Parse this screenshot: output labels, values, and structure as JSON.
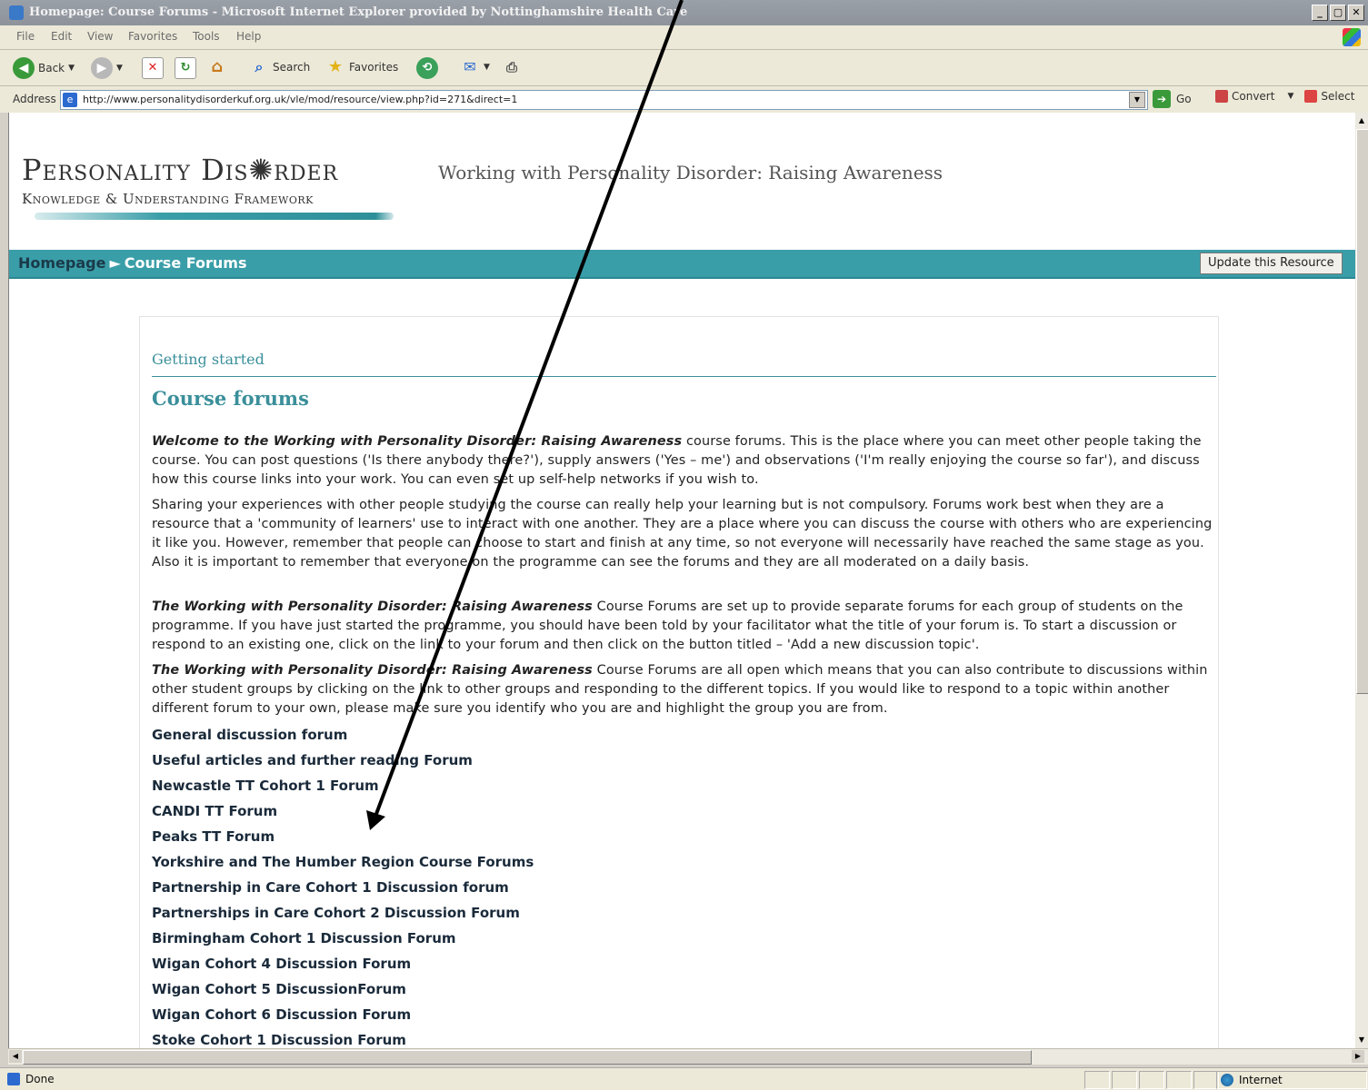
{
  "window": {
    "title": "Homepage: Course Forums - Microsoft Internet Explorer provided by Nottinghamshire Health Care",
    "controls": [
      "_",
      "▢",
      "✕"
    ]
  },
  "menu": [
    "File",
    "Edit",
    "View",
    "Favorites",
    "Tools",
    "Help"
  ],
  "toolbar": {
    "back_label": "Back",
    "search_label": "Search",
    "favorites_label": "Favorites"
  },
  "address": {
    "label": "Address",
    "url": "http://www.personalitydisorderkuf.org.uk/vle/mod/resource/view.php?id=271&direct=1",
    "go_label": "Go",
    "convert_label": "Convert",
    "select_label": "Select"
  },
  "page": {
    "logo_line1": "Personality Dis✺rder",
    "logo_line2": "Knowledge & Understanding Framework",
    "site_title": "Working with Personality Disorder: Raising Awareness",
    "breadcrumb_home": "Homepage",
    "breadcrumb_sep": "►",
    "breadcrumb_current": "Course Forums",
    "update_button": "Update this Resource",
    "section_label": "Getting started",
    "heading": "Course forums",
    "paragraphs": [
      {
        "bold": "Welcome to the Working with Personality Disorder: Raising Awareness",
        "text": " course forums. This is the place where you can meet other people taking the course. You can post questions ('Is there anybody there?'), supply answers ('Yes – me') and observations ('I'm really enjoying the course so far'), and discuss how this course links into your work. You can even set up self-help networks if you wish to."
      },
      {
        "bold": "",
        "text": "Sharing your experiences with other people studying the course can really help your learning but is not compulsory. Forums work best when they are a resource that a 'community of learners' use to interact with one another. They are a place where you can discuss the course with others who are experiencing it like you. However, remember that people can choose to start and finish at any time, so not everyone will necessarily have reached the same stage as you. Also it is important to remember that everyone on the programme can see the forums and they are all moderated on a daily basis."
      },
      {
        "bold": "The Working with Personality Disorder: Raising Awareness",
        "text": " Course Forums are set up to provide separate forums for each group of students on the programme. If you have just started the programme, you should have been told by your facilitator what the title of your forum is. To start a discussion or respond to an existing one, click on the link to your forum and then click on the button titled – 'Add a new discussion topic'."
      },
      {
        "bold": "The Working with Personality Disorder: Raising Awareness",
        "text": " Course Forums are all open which means that you can also contribute to discussions within other student groups by clicking on the link to other groups and responding to the different topics. If you would like to respond to a topic within another different forum to your own, please make sure you identify who you are and highlight the group you are from."
      }
    ],
    "forums": [
      "General discussion forum",
      "Useful articles and further reading Forum",
      "Newcastle TT Cohort 1 Forum",
      "CANDI TT Forum",
      "Peaks TT Forum",
      "Yorkshire and The Humber Region Course Forums",
      "Partnership in Care Cohort 1 Discussion forum",
      "Partnerships in Care Cohort 2 Discussion Forum",
      "Birmingham Cohort 1 Discussion Forum",
      "Wigan Cohort 4 Discussion Forum",
      "Wigan Cohort 5 DiscussionForum",
      "Wigan Cohort 6 Discussion Forum",
      "Stoke Cohort 1 Discussion Forum"
    ]
  },
  "status": {
    "left": "Done",
    "zone": "Internet"
  },
  "colors": {
    "accent": "#3a9ea8",
    "heading": "#3a8f9a"
  }
}
